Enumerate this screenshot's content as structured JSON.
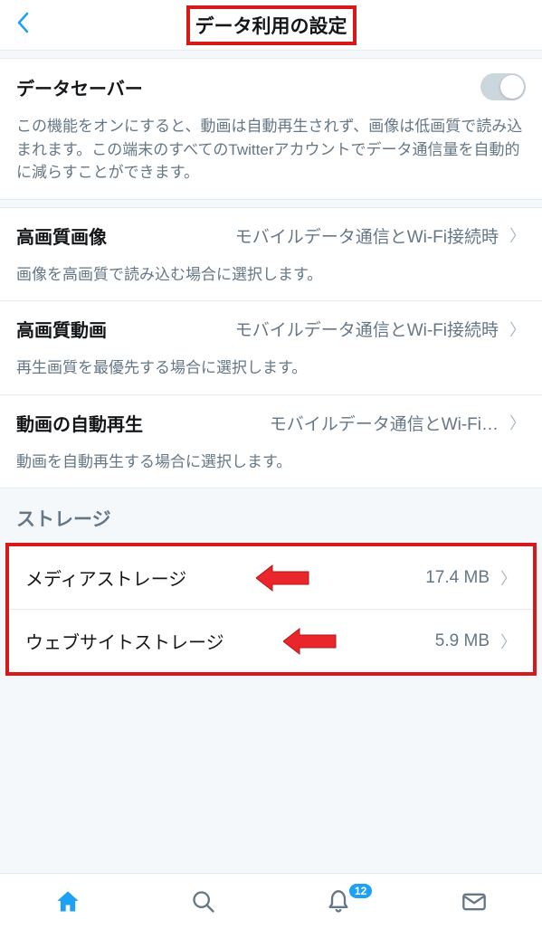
{
  "header": {
    "title": "データ利用の設定"
  },
  "dataSaver": {
    "label": "データセーバー",
    "description": "この機能をオンにすると、動画は自動再生されず、画像は低画質で読み込まれます。この端末のすべてのTwitterアカウントでデータ通信量を自動的に減らすことができます。"
  },
  "hqImage": {
    "label": "高画質画像",
    "value": "モバイルデータ通信とWi-Fi接続時",
    "description": "画像を高画質で読み込む場合に選択します。"
  },
  "hqVideo": {
    "label": "高画質動画",
    "value": "モバイルデータ通信とWi-Fi接続時",
    "description": "再生画質を最優先する場合に選択します。"
  },
  "autoplay": {
    "label": "動画の自動再生",
    "value": "モバイルデータ通信とWi-Fi…",
    "description": "動画を自動再生する場合に選択します。"
  },
  "storage": {
    "header": "ストレージ",
    "media": {
      "label": "メディアストレージ",
      "value": "17.4 MB"
    },
    "web": {
      "label": "ウェブサイトストレージ",
      "value": "5.9 MB"
    }
  },
  "tabbar": {
    "notificationBadge": "12"
  },
  "colors": {
    "accent": "#1da1f2",
    "highlight": "#d7191c"
  }
}
